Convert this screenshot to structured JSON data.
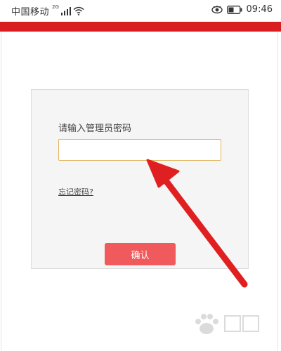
{
  "status_bar": {
    "carrier": "中国移动",
    "network_badge": "2G",
    "time": "09:46"
  },
  "form": {
    "prompt_label": "请输入管理员密码",
    "password_value": "",
    "forgot_link": "忘记密码?",
    "confirm_label": "确认"
  },
  "colors": {
    "top_bar": "#d81e20",
    "button": "#f05a5c",
    "arrow": "#e02020"
  },
  "icons": [
    "signal-icon",
    "wifi-icon",
    "eye-icon",
    "battery-icon",
    "annotation-arrow-icon",
    "watermark-icon"
  ]
}
